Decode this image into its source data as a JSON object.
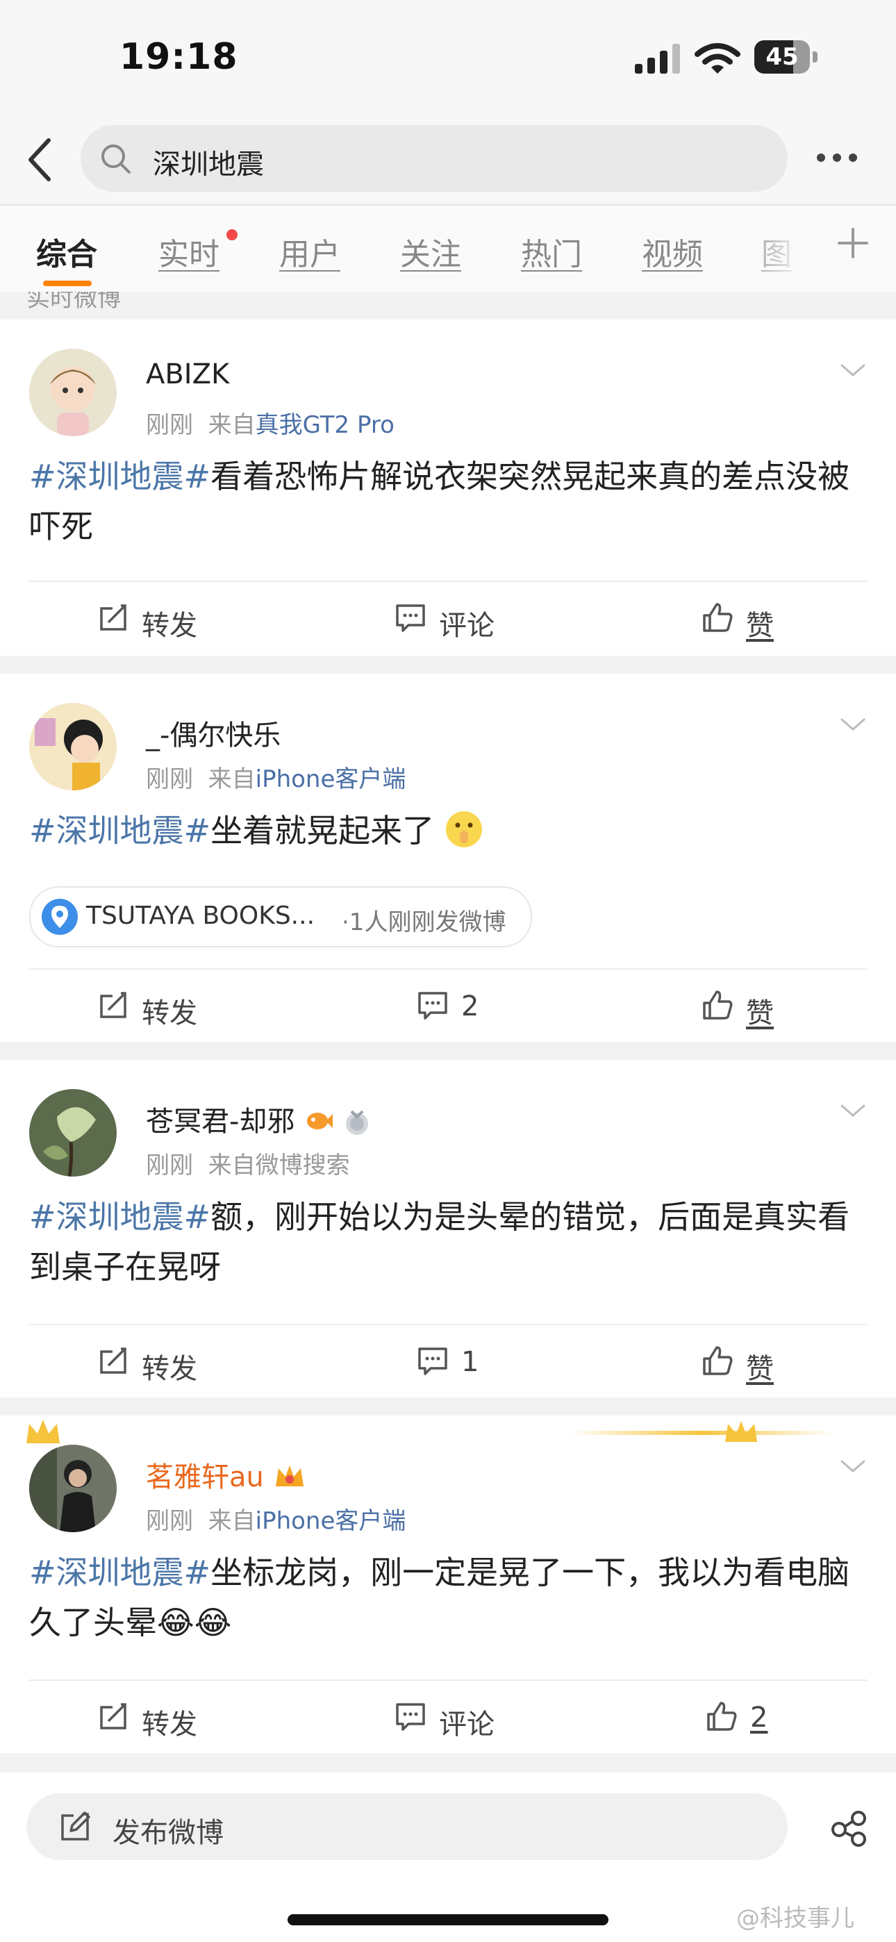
{
  "status_bar": {
    "time": "19:18",
    "battery": "45"
  },
  "search": {
    "query": "深圳地震"
  },
  "tabs": [
    {
      "label": "综合",
      "active": true
    },
    {
      "label": "实时",
      "badge": true
    },
    {
      "label": "用户"
    },
    {
      "label": "关注"
    },
    {
      "label": "热门"
    },
    {
      "label": "视频"
    },
    {
      "label": "图"
    }
  ],
  "section_label": "实时微博",
  "posts": [
    {
      "username": "ABIZK",
      "time": "刚刚",
      "from": "来自",
      "source": "真我GT2 Pro",
      "hashtag": "#深圳地震#",
      "text": "看着恐怖片解说衣架突然晃起来真的差点没被吓死",
      "repost": "转发",
      "comment": "评论",
      "like": "赞"
    },
    {
      "username": "_-偶尔快乐",
      "time": "刚刚",
      "from": "来自",
      "source": "iPhone客户端",
      "hashtag": "#深圳地震#",
      "text": "坐着就晃起来了",
      "location": "TSUTAYA BOOKS...",
      "location_extra": "·1人刚刚发微博",
      "repost": "转发",
      "comment": "2",
      "like": "赞"
    },
    {
      "username": "苍冥君-却邪",
      "time": "刚刚",
      "from": "来自微博搜索",
      "source": "",
      "hashtag": "#深圳地震#",
      "text": "额，刚开始以为是头晕的错觉，后面是真实看到桌子在晃呀",
      "repost": "转发",
      "comment": "1",
      "like": "赞"
    },
    {
      "username": "茗雅轩au",
      "time": "刚刚",
      "from": "来自",
      "source": "iPhone客户端",
      "hashtag": "#深圳地震#",
      "text": "坐标龙岗，刚一定是晃了一下，我以为看电脑久了头晕",
      "emoji": "😂😂",
      "repost": "转发",
      "comment": "评论",
      "like": "2"
    }
  ],
  "bottom": {
    "compose_label": "发布微博",
    "watermark": "@科技事儿"
  },
  "colors": {
    "accent": "#ff8200",
    "link": "#4b76a8",
    "vip_name": "#e8681e"
  }
}
